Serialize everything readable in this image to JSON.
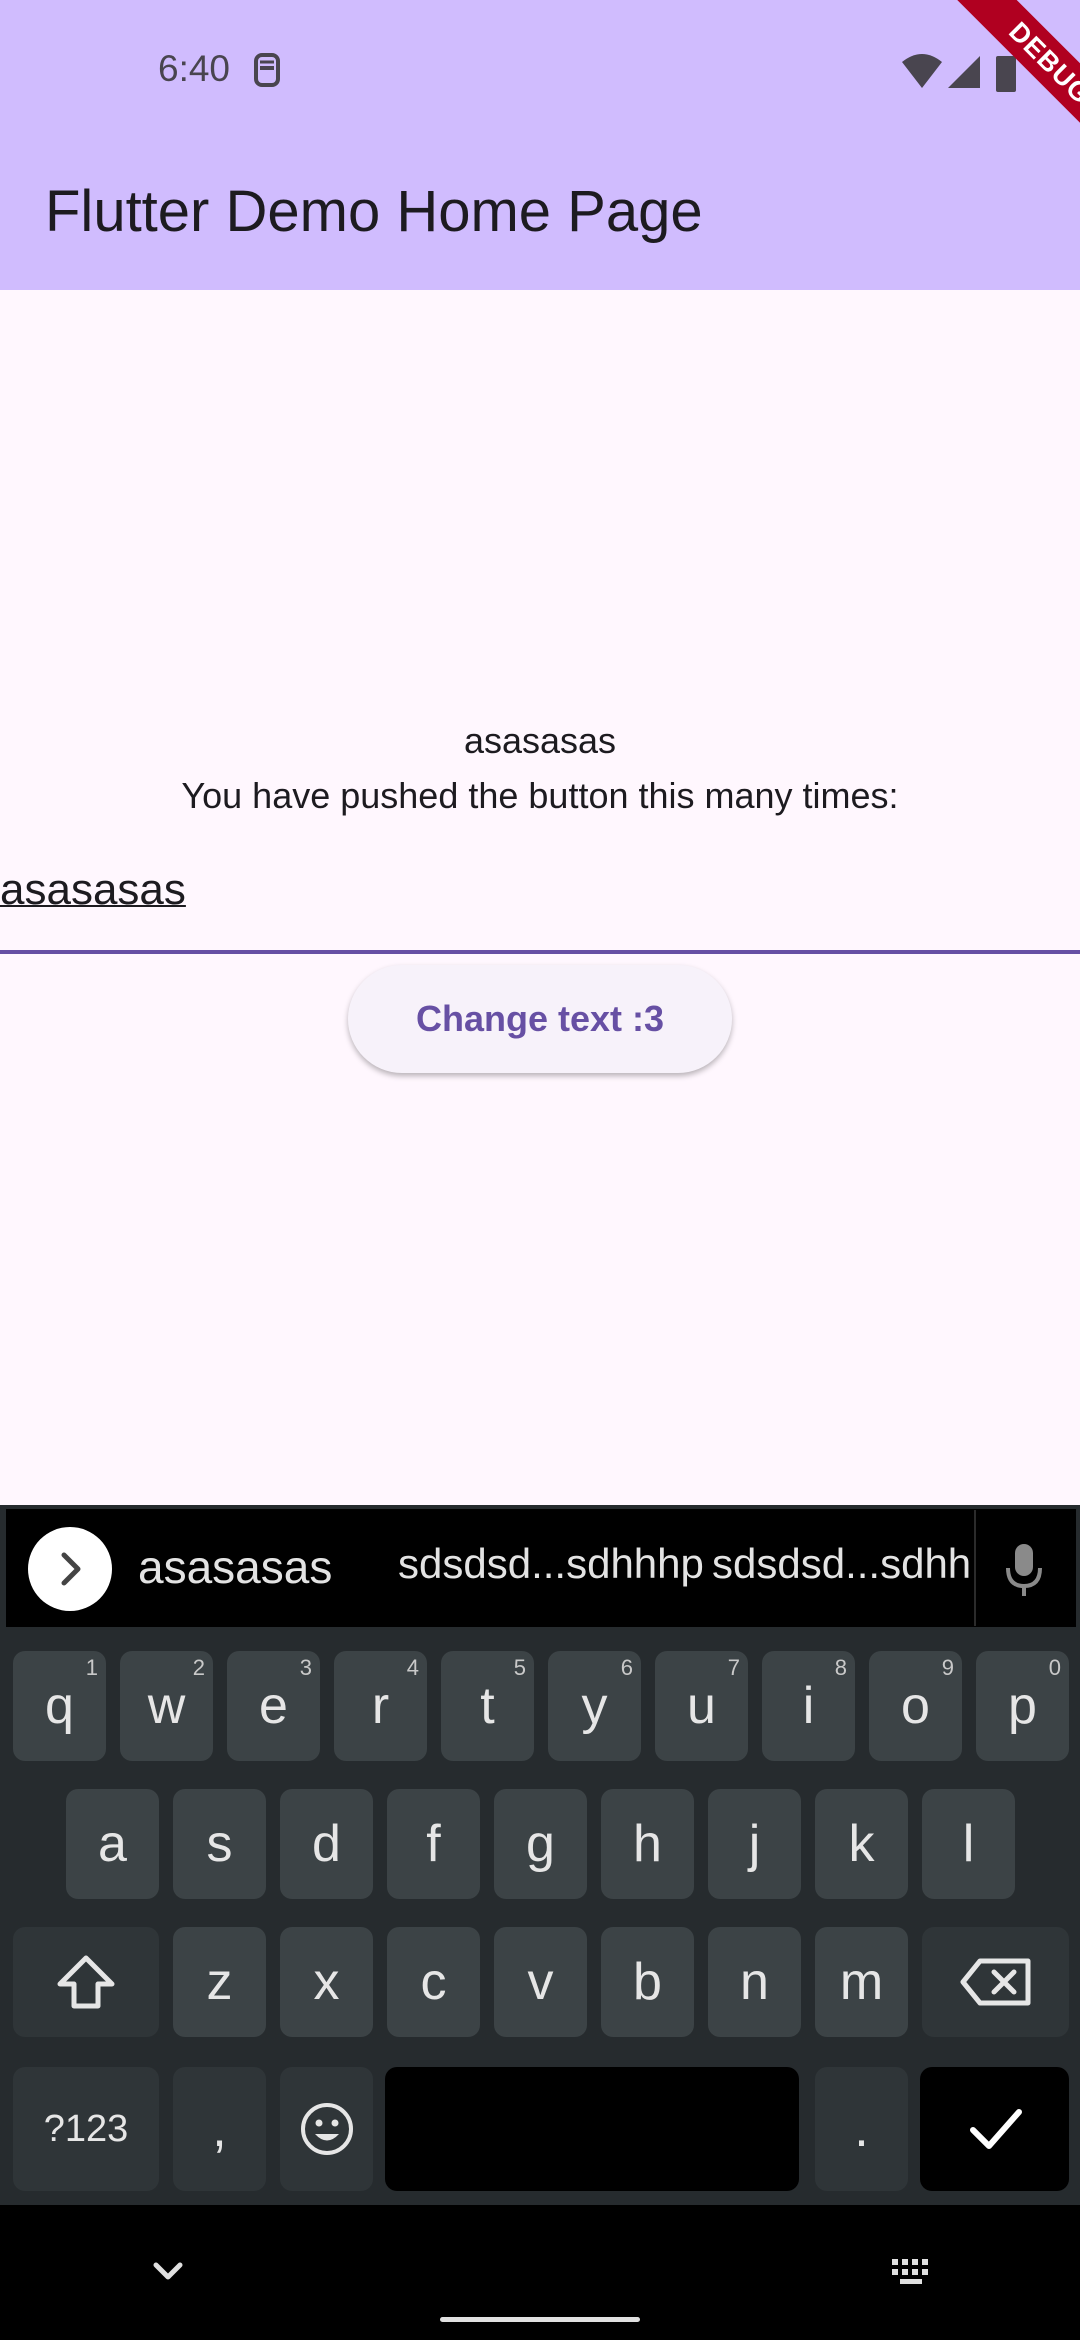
{
  "status_bar": {
    "time": "6:40"
  },
  "debug_banner": {
    "label": "DEBUG"
  },
  "app_bar": {
    "title": "Flutter Demo Home Page"
  },
  "main": {
    "label_text": "asasasas",
    "counter_label": "You have pushed the button this many times:",
    "input_value": "asasasas",
    "button_label": "Change text :3"
  },
  "keyboard": {
    "suggestions": [
      "asasasas",
      "sdsdsd...sdhhhp",
      "sdsdsd...sdhh"
    ],
    "row1": [
      "q",
      "w",
      "e",
      "r",
      "t",
      "y",
      "u",
      "i",
      "o",
      "p"
    ],
    "row1_hints": [
      "1",
      "2",
      "3",
      "4",
      "5",
      "6",
      "7",
      "8",
      "9",
      "0"
    ],
    "row2": [
      "a",
      "s",
      "d",
      "f",
      "g",
      "h",
      "j",
      "k",
      "l"
    ],
    "row3": [
      "z",
      "x",
      "c",
      "v",
      "b",
      "n",
      "m"
    ],
    "symbols_label": "?123",
    "comma_label": ",",
    "period_label": "."
  },
  "colors": {
    "accent": "#6750a4",
    "app_bar": "#d0bcfe",
    "background": "#fff7fe"
  }
}
